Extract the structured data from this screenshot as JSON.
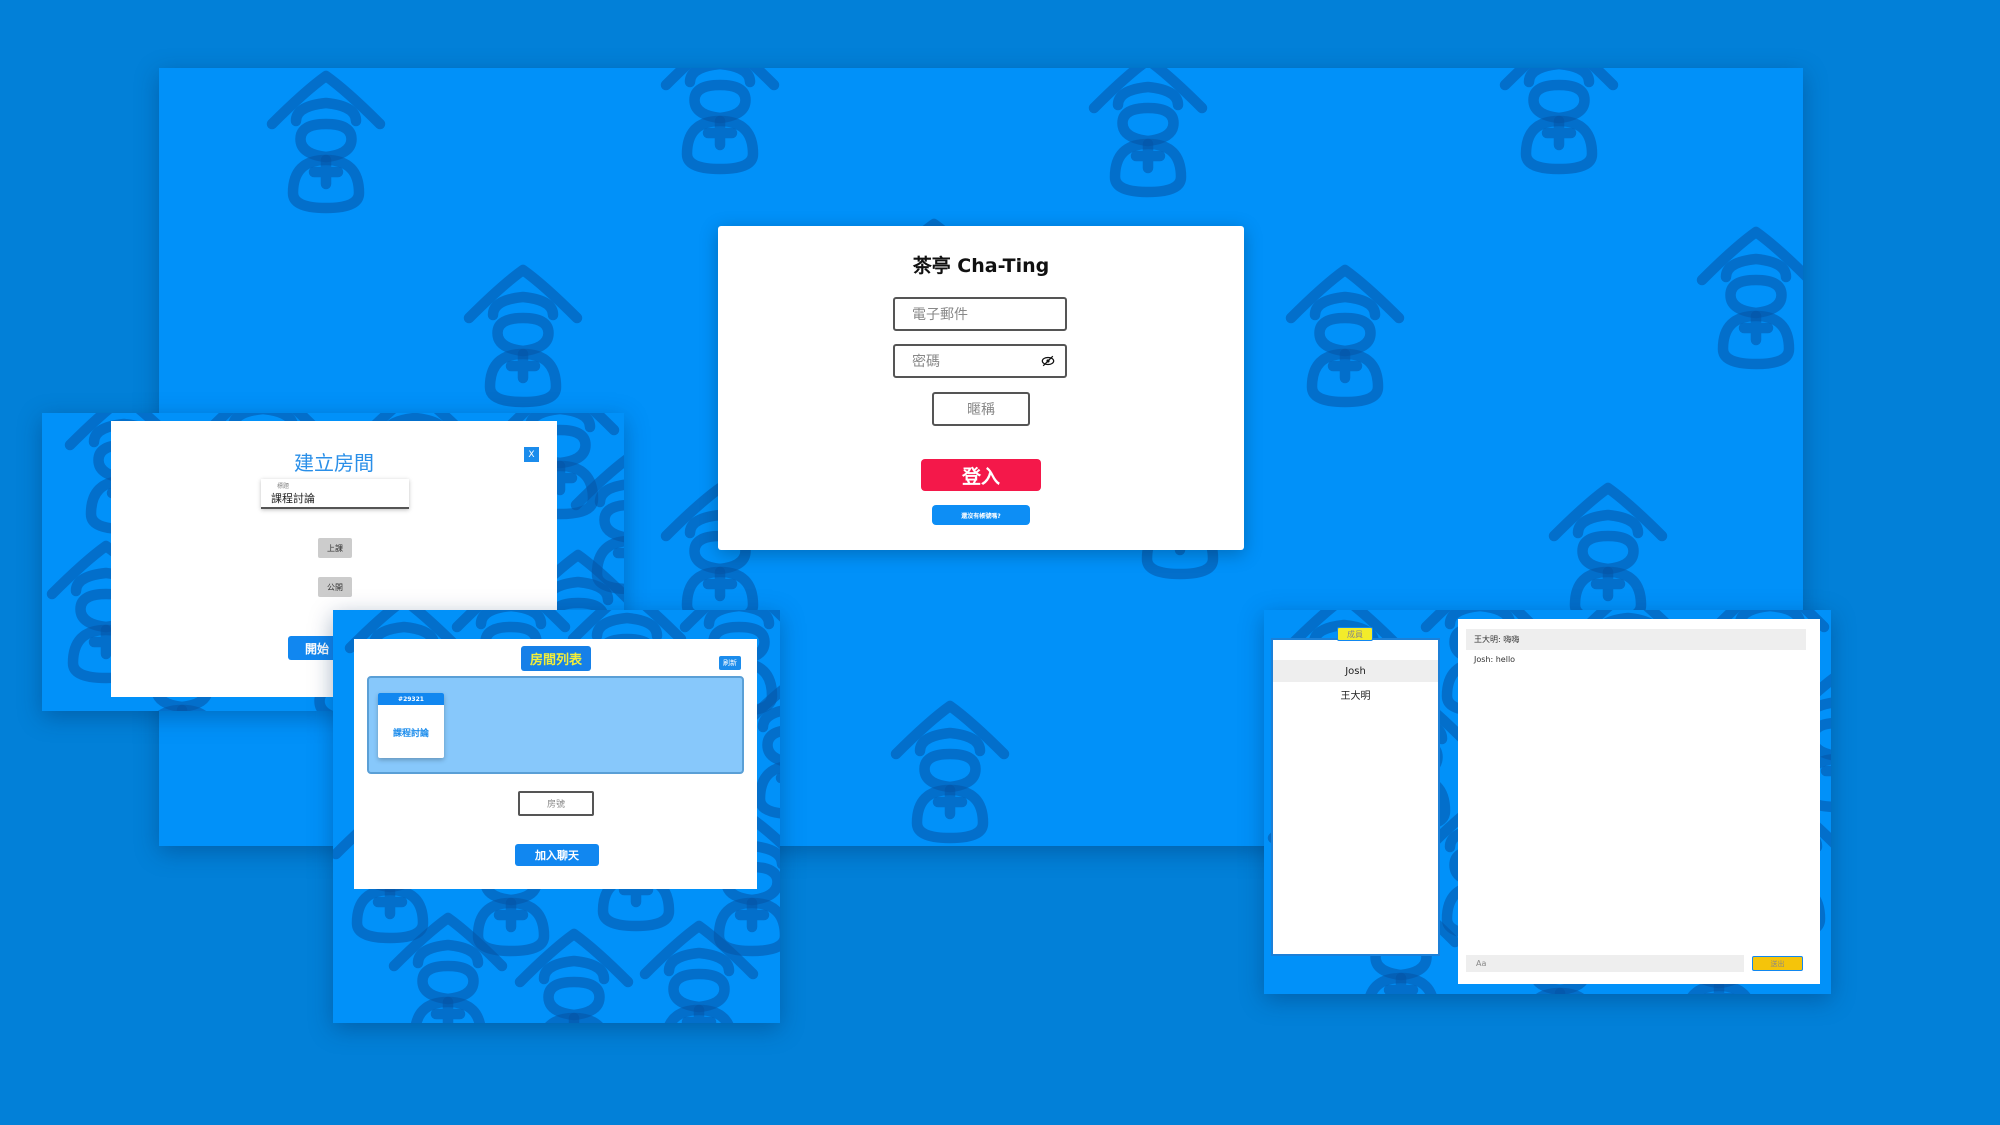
{
  "colors": {
    "page_background": "#0280d8",
    "panel_background": "#0191f9",
    "accent_blue": "#1187f0",
    "login_red": "#f4184a",
    "highlight_yellow": "#f3ec2a",
    "send_yellow": "#f5c40a",
    "pattern_motif": "#0554a5"
  },
  "background_motif_icon": "tea-house-logo-icon",
  "login": {
    "title": "茶亭 Cha-Ting",
    "email_placeholder": "電子郵件",
    "password_placeholder": "密碼",
    "password_toggle_icon": "eye-slash-icon",
    "nickname_placeholder": "暱稱",
    "login_label": "登入",
    "forgot_label": "還沒有帳號嗎?"
  },
  "create_room": {
    "title": "建立房間",
    "close_label": "X",
    "room_name_label": "標題",
    "room_name_value": "課程討論",
    "type_chip": "上課",
    "visibility_chip": "公開",
    "start_label": "開始"
  },
  "room_list": {
    "title": "房間列表",
    "refresh_label": "刷新",
    "rooms": [
      {
        "id": "#29321",
        "name": "課程討論"
      }
    ],
    "room_number_placeholder": "房號",
    "join_label": "加入聊天"
  },
  "chat": {
    "members_label": "成員",
    "members": [
      "Josh",
      "王大明"
    ],
    "messages": [
      "王大明: 嗨嗨",
      "Josh: hello"
    ],
    "input_placeholder": "Aa",
    "send_label": "送出"
  }
}
